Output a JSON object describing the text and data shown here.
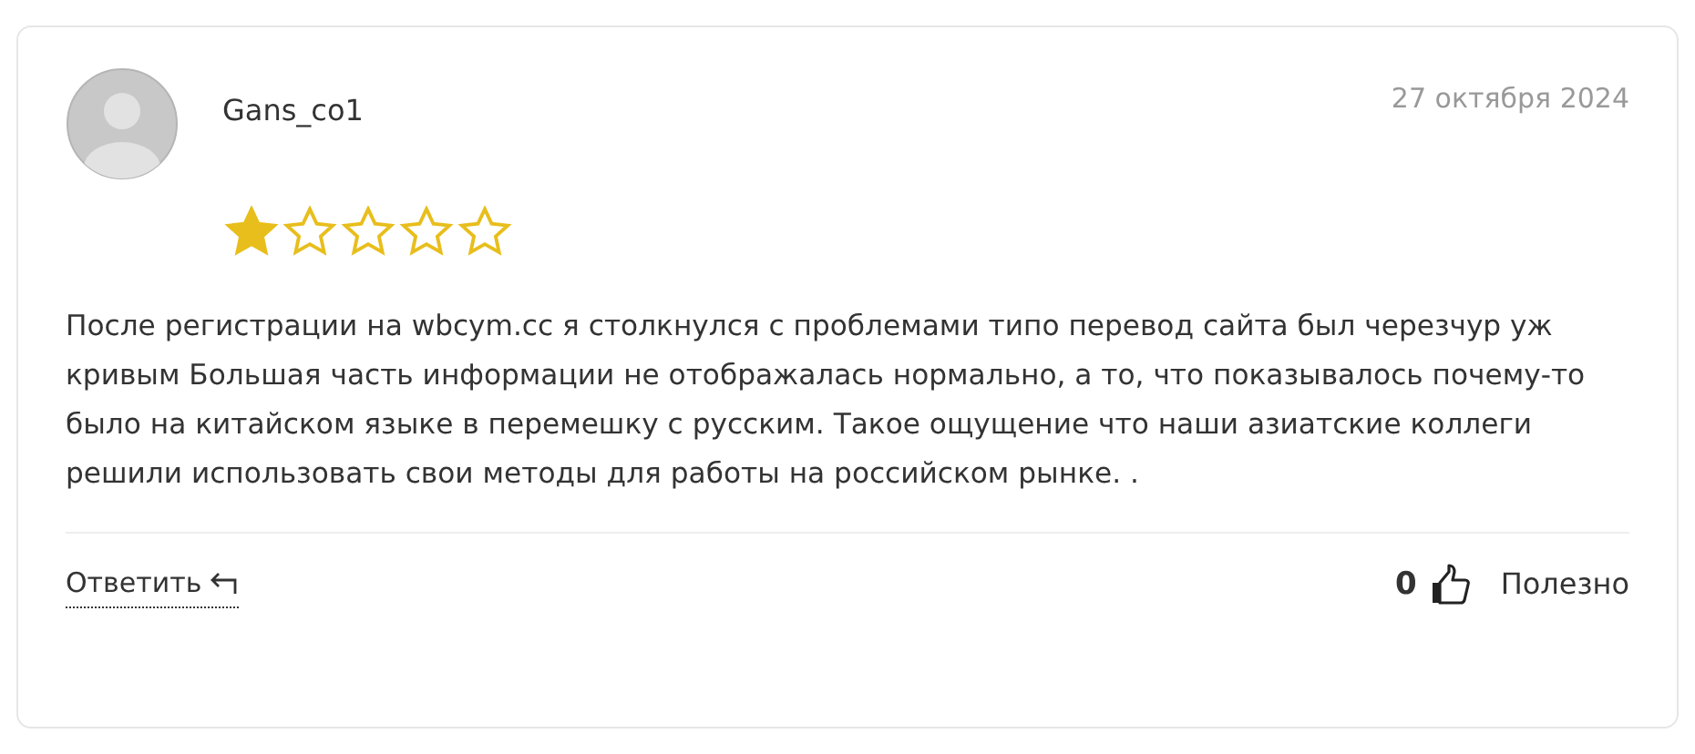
{
  "review": {
    "author": "Gans_co1",
    "date": "27 октября 2024",
    "stars": 1,
    "text": "После регистрации на wbcym.cc я столкнулся с проблемами типо перевод сайта был черезчур уж кривым Большая часть информации не отображалась нормально, а то, что показывалось почему-то было на китайском языке в перемешку с русским. Такое ощущение что наши азиатские коллеги решили использовать свои методы для работы на российском рынке. .",
    "reply_label": "Ответить",
    "helpful_count": "0",
    "helpful_label": "Полезно"
  }
}
